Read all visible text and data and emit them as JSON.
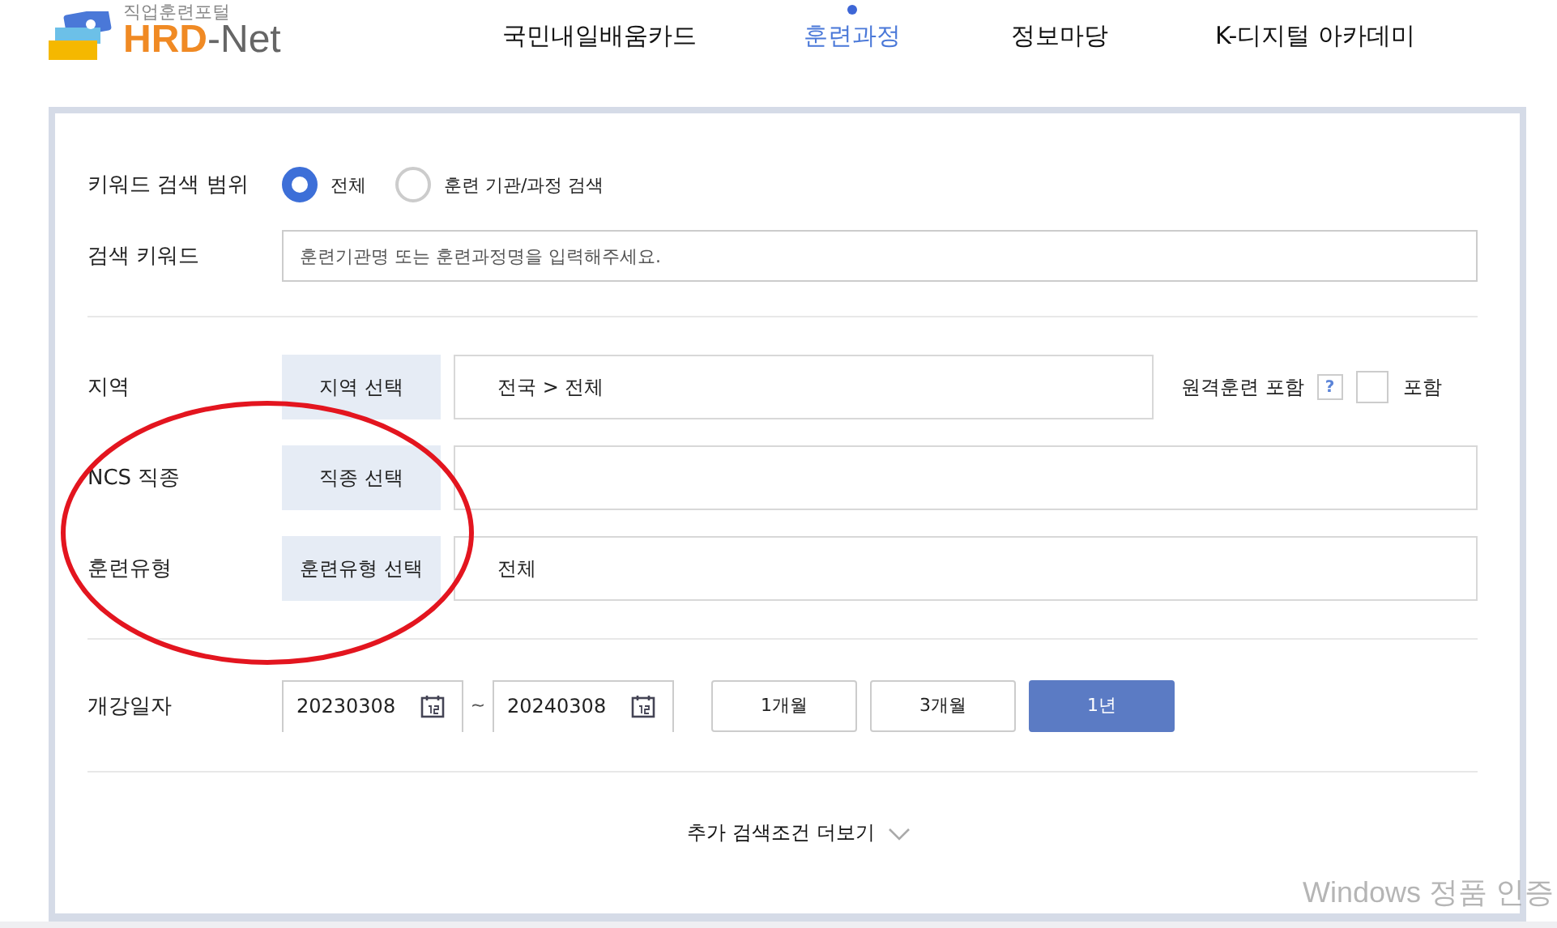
{
  "header": {
    "logo": {
      "tagline": "직업훈련포털",
      "name_a": "HRD",
      "dash": "-",
      "name_b": "Net"
    },
    "nav": [
      {
        "label": "국민내일배움카드",
        "selected": false
      },
      {
        "label": "훈련과정",
        "selected": true
      },
      {
        "label": "정보마당",
        "selected": false
      },
      {
        "label": "K-디지털 아카데미",
        "selected": false
      }
    ]
  },
  "search": {
    "scope": {
      "label": "키워드 검색 범위",
      "options": [
        {
          "label": "전체",
          "selected": true
        },
        {
          "label": "훈련 기관/과정 검색",
          "selected": false
        }
      ]
    },
    "keyword": {
      "label": "검색 키워드",
      "placeholder": "훈련기관명 또는 훈련과정명을 입력해주세요."
    },
    "region": {
      "label": "지역",
      "button": "지역 선택",
      "value": "전국 > 전체",
      "remote": {
        "label": "원격훈련 포함",
        "help": "?",
        "checkbox_label": "포함",
        "checked": false
      }
    },
    "ncs": {
      "label": "NCS 직종",
      "button": "직종 선택"
    },
    "type": {
      "label": "훈련유형",
      "button": "훈련유형 선택",
      "value": "전체"
    },
    "date": {
      "label": "개강일자",
      "from": "20230308",
      "separator": "~",
      "to": "20240308",
      "periods": [
        {
          "label": "1개월",
          "selected": false
        },
        {
          "label": "3개월",
          "selected": false
        },
        {
          "label": "1년",
          "selected": true
        }
      ]
    },
    "more": "추가 검색조건 더보기"
  },
  "os_watermark": "Windows 정품 인증"
}
